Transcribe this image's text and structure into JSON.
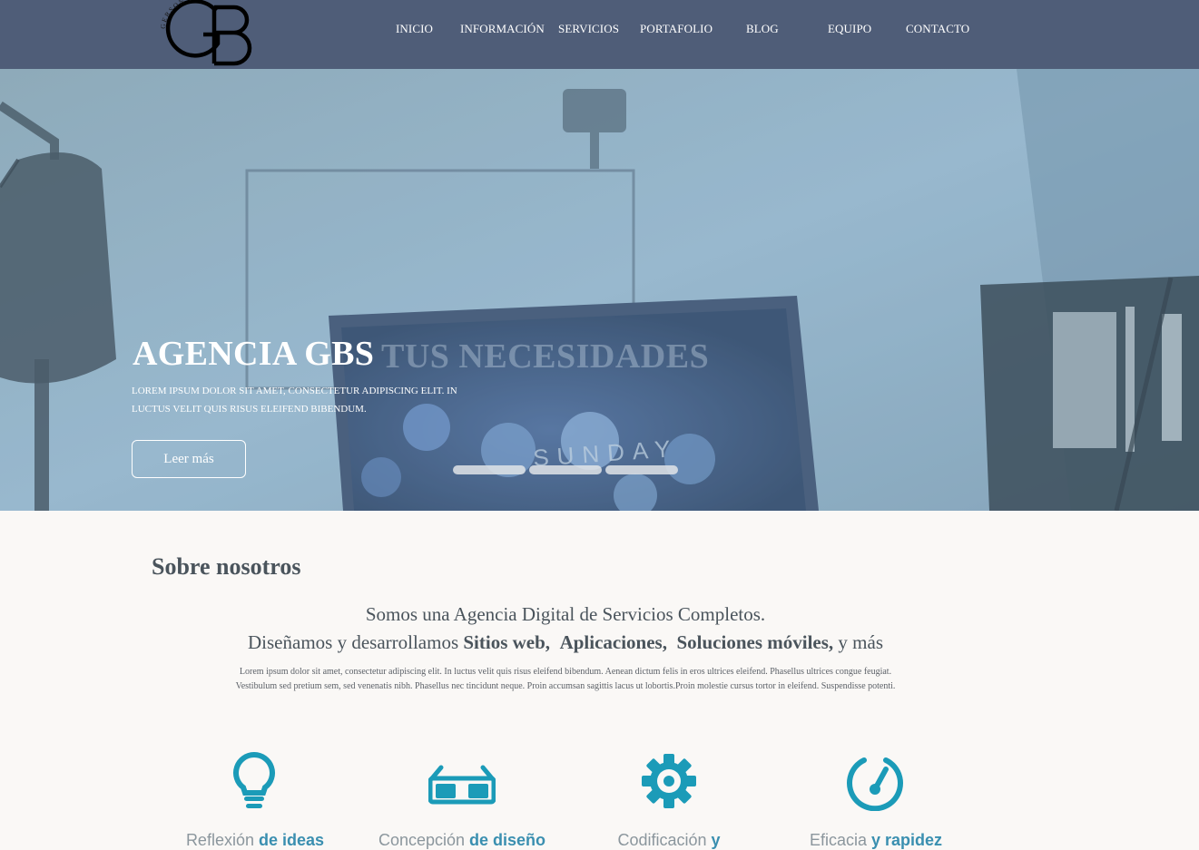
{
  "logo": {
    "letters": "GB",
    "arc_text": "GERSON BAHENA"
  },
  "nav": {
    "items": [
      {
        "label": "INICIO"
      },
      {
        "label": "INFORMACIÓN"
      },
      {
        "label": "SERVICIOS"
      },
      {
        "label": "PORTAFOLIO"
      },
      {
        "label": "BLOG"
      },
      {
        "label": "EQUIPO"
      },
      {
        "label": "CONTACTO"
      }
    ]
  },
  "hero": {
    "title": "AGENCIA GBS",
    "ghost_text": "TUS NECESIDADES",
    "subtitle": "LOREM IPSUM DOLOR SIT AMET, CONSECTETUR ADIPISCING ELIT. IN LUCTUS VELIT QUIS RISUS ELEIFEND BIBENDUM.",
    "button_label": "Leer más",
    "monitor_text": "SUNDAY",
    "slide_count": 3
  },
  "about": {
    "heading": "Sobre nosotros",
    "line1": "Somos una Agencia Digital de Servicios Completos.",
    "line2": {
      "prefix": "Diseñamos y desarrollamos",
      "bold1": "Sitios web,",
      "bold2": "Aplicaciones,",
      "bold3": "Soluciones móviles,",
      "suffix": "y más"
    },
    "body": "Lorem ipsum dolor sit amet, consectetur adipiscing elit. In luctus velit quis risus eleifend bibendum. Aenean dictum felis in eros ultrices eleifend. Phasellus ultrices congue feugiat. Vestibulum sed pretium sem, sed venenatis nibh. Phasellus nec tincidunt neque. Proin accumsan sagittis lacus ut lobortis.Proin molestie cursus tortor in eleifend. Suspendisse potenti."
  },
  "features": [
    {
      "icon": "lightbulb-icon",
      "label": "Reflexión",
      "highlight": "de ideas"
    },
    {
      "icon": "glasses-icon",
      "label": "Concepción",
      "highlight": "de diseño"
    },
    {
      "icon": "gear-icon",
      "label": "Codificación",
      "highlight": "y"
    },
    {
      "icon": "speedometer-icon",
      "label": "Eficacia",
      "highlight": "y rapidez"
    }
  ],
  "colors": {
    "nav_bg": "#4f5d78",
    "accent": "#1b9bb8",
    "highlight_text": "#3a8fb0",
    "page_bg": "#faf8f6"
  }
}
